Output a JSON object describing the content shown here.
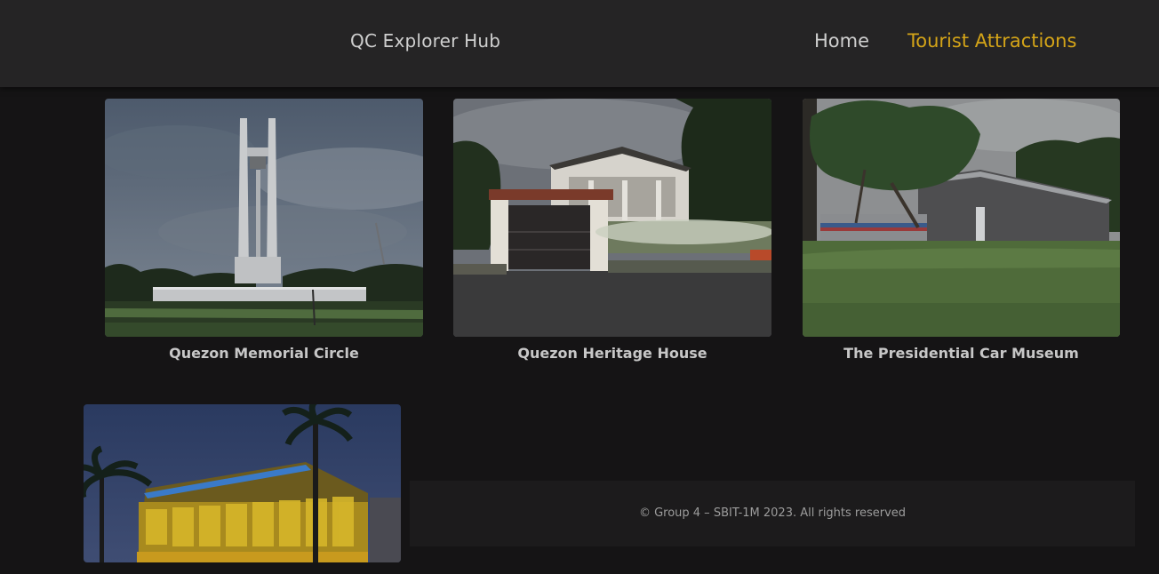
{
  "header": {
    "brand": "QC Explorer Hub",
    "nav": {
      "home_label": "Home",
      "attractions_label": "Tourist Attractions"
    }
  },
  "colors": {
    "accent": "#d4a418",
    "header_bg": "#252425",
    "page_bg": "#151415",
    "nav_text": "#cfcfcf"
  },
  "cards": [
    {
      "caption": "Quezon Memorial Circle",
      "image": "obelisk-monument-photo"
    },
    {
      "caption": "Quezon Heritage House",
      "image": "heritage-house-photo"
    },
    {
      "caption": "The Presidential Car Museum",
      "image": "car-museum-photo"
    },
    {
      "caption": "",
      "image": "mall-building-photo"
    }
  ],
  "footer": {
    "text": "© Group 4 – SBIT-1M 2023. All rights reserved"
  }
}
